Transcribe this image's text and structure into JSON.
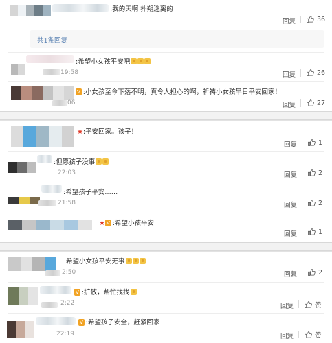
{
  "block1": {
    "top_comment": {
      "text": ":我的天啊 扑朔迷离的",
      "likes": "36",
      "reply": "回复"
    },
    "more_replies": "共1条回复",
    "comments": [
      {
        "text": ":希望小女孩平安吧",
        "time": "19:58",
        "likes": "26",
        "reply": "回复"
      },
      {
        "text": ":小女孩至今下落不明，真令人担心的啊，祈祷小女孩早日平安回家！",
        "time": "06",
        "likes": "27",
        "reply": "回复"
      }
    ]
  },
  "block2": {
    "comments": [
      {
        "text": ":平安回家。孩子！",
        "likes": "1",
        "reply": "回复"
      },
      {
        "text": ":但愿孩子没事",
        "time": "22:03",
        "likes": "2",
        "reply": "回复"
      },
      {
        "text": ":希望孩子平安……",
        "time": "21:58",
        "likes": "2",
        "reply": "回复"
      },
      {
        "text": ":希望小孩平安",
        "likes": "1",
        "reply": "回复"
      }
    ]
  },
  "block3": {
    "comments": [
      {
        "text": "希望小女孩平安无事",
        "time": "2:50",
        "likes": "2",
        "reply": "回复"
      },
      {
        "text": ":扩散，帮忙找找",
        "time": "2:22",
        "likes": "赞",
        "reply": "回复"
      },
      {
        "text": ":希望孩子安全，赶紧回家",
        "time": "22:19",
        "likes": "赞",
        "reply": "回复"
      }
    ]
  },
  "badges": {
    "vip": "V",
    "star": "★"
  },
  "colors": {
    "link": "#5d84b4",
    "star": "#e03b2a",
    "emoji": "#f3c445"
  },
  "icons": [
    "thumbs-up-icon",
    "star-icon",
    "vip-badge-icon",
    "emoji-icon"
  ]
}
